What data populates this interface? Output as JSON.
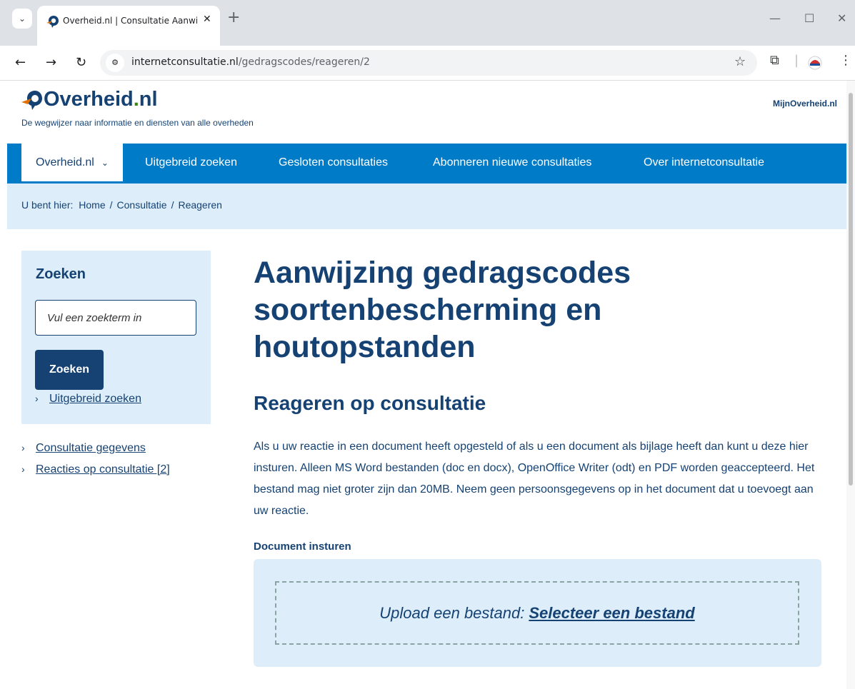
{
  "browser": {
    "tab_title": "Overheid.nl | Consultatie Aanwij",
    "url_host": "internetconsultatie.nl",
    "url_path": "/gedragscodes/reageren/2",
    "tab_close_glyph": "✕",
    "new_tab_glyph": "+"
  },
  "header": {
    "logo_main": "Overheid",
    "logo_dot": ".",
    "logo_tld": "nl",
    "tagline": "De wegwijzer naar informatie en diensten van alle overheden",
    "mijn_link": "MijnOverheid.nl"
  },
  "nav": {
    "items": [
      {
        "label": "Overheid.nl"
      },
      {
        "label": "Uitgebreid zoeken"
      },
      {
        "label": "Gesloten consultaties"
      },
      {
        "label": "Abonneren nieuwe consultaties"
      },
      {
        "label": "Over internetconsultatie"
      }
    ]
  },
  "breadcrumb": {
    "prefix": "U bent hier:",
    "items": [
      "Home",
      "Consultatie",
      "Reageren"
    ],
    "separator": "/"
  },
  "sidebar": {
    "search_title": "Zoeken",
    "search_placeholder": "Vul een zoekterm in",
    "search_button": "Zoeken",
    "advanced_link": "Uitgebreid zoeken",
    "links": [
      {
        "label": "Consultatie gegevens"
      },
      {
        "label": "Reacties op consultatie [2]"
      }
    ]
  },
  "main": {
    "title": "Aanwijzing gedragscodes soortenbescherming en houtopstanden",
    "subtitle": "Reageren op consultatie",
    "intro": "Als u uw reactie in een document heeft opgesteld of als u een document als bijlage heeft dan kunt u deze hier insturen. Alleen MS Word bestanden (doc en docx), OpenOffice Writer (odt) en PDF worden geaccepteerd. Het bestand mag niet groter zijn dan 20MB. Neem geen persoonsgegevens op in het document dat u toevoegt aan uw reactie.",
    "upload_label": "Document insturen",
    "upload_prefix": "Upload een bestand:",
    "upload_link": "Selecteer een bestand"
  },
  "colors": {
    "brand_blue": "#154273",
    "nav_blue": "#007bc7",
    "light_blue": "#ddeefa"
  }
}
